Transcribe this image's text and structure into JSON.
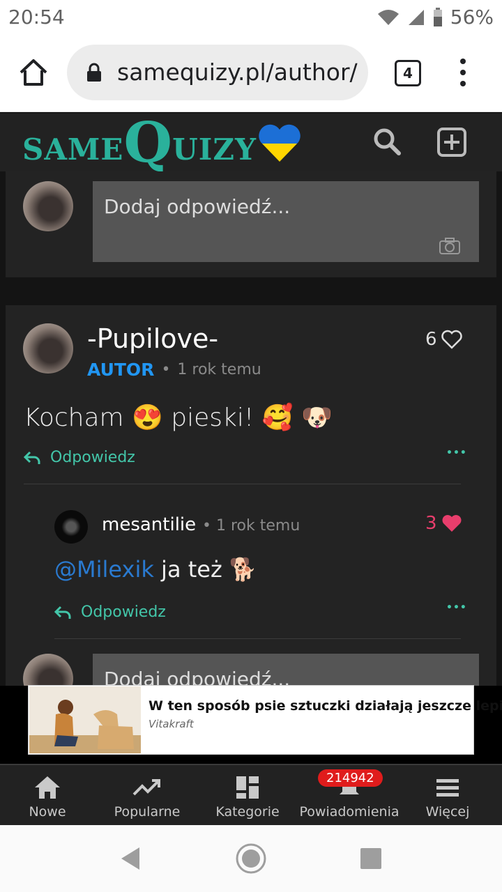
{
  "status_bar": {
    "time": "20:54",
    "battery": "56%"
  },
  "browser": {
    "url": "samequizy.pl/author/",
    "tab_count": "4"
  },
  "site": {
    "logo_same": "SAME",
    "logo_q": "Q",
    "logo_uizy": "UIZY"
  },
  "reply_box": {
    "placeholder": "Dodaj odpowiedź..."
  },
  "comment": {
    "author": "-Pupilove-",
    "badge": "AUTOR",
    "time": "1 rok temu",
    "likes": "6",
    "text": "Kocham 😍 pieski! 🥰 🐶",
    "reply_label": "Odpowiedz",
    "more": "•••"
  },
  "reply": {
    "author": "mesantilie",
    "time": "1 rok temu",
    "likes": "3",
    "mention": "@Milexik",
    "text": " ja też 🐕",
    "reply_label": "Odpowiedz",
    "more": "•••"
  },
  "reply_box_bottom": {
    "placeholder": "Dodaj odpowiedź..."
  },
  "ad": {
    "title": "W ten sposób psie sztuczki działają jeszcze lepiej.",
    "source": "Vitakraft"
  },
  "bottom_nav": {
    "items": [
      {
        "label": "Nowe",
        "icon": "home-icon"
      },
      {
        "label": "Popularne",
        "icon": "trending-icon"
      },
      {
        "label": "Kategorie",
        "icon": "grid-icon"
      },
      {
        "label": "Powiadomienia",
        "icon": "bell-icon"
      },
      {
        "label": "Więcej",
        "icon": "menu-icon"
      }
    ],
    "notifications_count": "214942"
  },
  "colors": {
    "accent": "#2ab19b",
    "reply_accent": "#43c6a9",
    "author_badge": "#2196f3",
    "like_active": "#e83e6c",
    "badge_red": "#e01c1c"
  }
}
